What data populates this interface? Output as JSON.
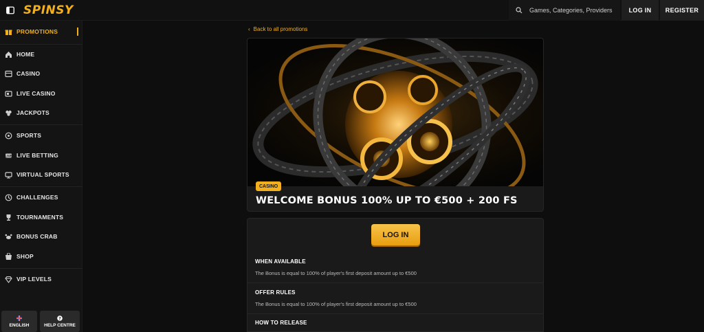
{
  "brand": {
    "logo": "SPINSY",
    "accent": "#f2b01e"
  },
  "header": {
    "search_placeholder": "Games, Categories, Providers",
    "login_label": "LOG IN",
    "register_label": "REGISTER"
  },
  "sidebar": {
    "items": [
      {
        "label": "PROMOTIONS",
        "icon": "gift-icon"
      },
      {
        "label": "HOME",
        "icon": "home-icon"
      },
      {
        "label": "CASINO",
        "icon": "casino-icon"
      },
      {
        "label": "LIVE CASINO",
        "icon": "live-casino-icon"
      },
      {
        "label": "JACKPOTS",
        "icon": "jackpot-icon"
      },
      {
        "label": "SPORTS",
        "icon": "sports-icon"
      },
      {
        "label": "LIVE BETTING",
        "icon": "live-betting-icon"
      },
      {
        "label": "VIRTUAL SPORTS",
        "icon": "virtual-sports-icon"
      },
      {
        "label": "CHALLENGES",
        "icon": "challenges-icon"
      },
      {
        "label": "TOURNAMENTS",
        "icon": "trophy-icon"
      },
      {
        "label": "BONUS CRAB",
        "icon": "crab-icon"
      },
      {
        "label": "SHOP",
        "icon": "shop-icon"
      },
      {
        "label": "VIP LEVELS",
        "icon": "diamond-icon"
      }
    ],
    "footer": {
      "language_label": "ENGLISH",
      "help_label": "HELP CENTRE"
    }
  },
  "promo": {
    "back_label": "Back to all promotions",
    "badge": "CASINO",
    "title": "WELCOME BONUS 100% UP TO €500 + 200 FS",
    "login_label": "LOG IN",
    "sections": [
      {
        "heading": "WHEN AVAILABLE",
        "text": "The Bonus is equal to 100% of player's first deposit amount up to €500"
      },
      {
        "heading": "OFFER RULES",
        "text": "The Bonus is equal to 100% of player's first deposit amount up to €500"
      },
      {
        "heading": "HOW TO RELEASE",
        "text": ""
      }
    ]
  }
}
